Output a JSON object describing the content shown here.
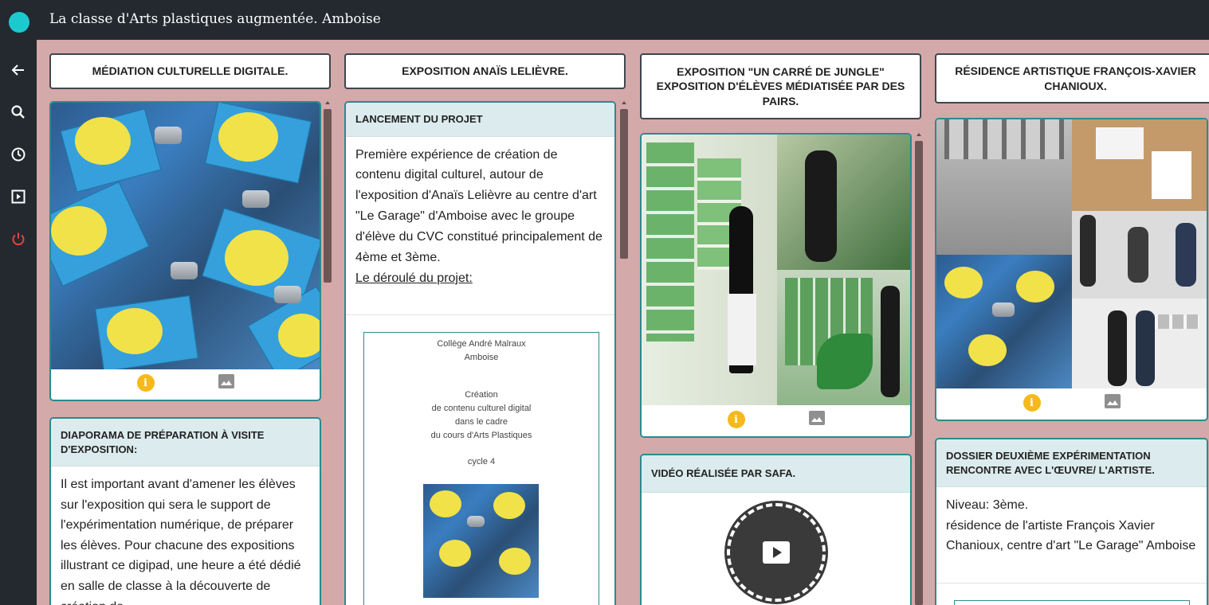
{
  "app": {
    "title": "La classe d'Arts plastiques augmentée. Amboise"
  },
  "sidebar": {
    "items": [
      {
        "icon": "back-arrow-icon"
      },
      {
        "icon": "search-icon"
      },
      {
        "icon": "clock-icon"
      },
      {
        "icon": "slideshow-icon"
      },
      {
        "icon": "power-icon"
      }
    ]
  },
  "colors": {
    "background": "#d4a9a9",
    "topbar": "#23292f",
    "accent_teal": "#2b8a8e",
    "logo": "#1cc9cf",
    "power": "#e0463b",
    "info": "#f5b91b"
  },
  "columns": [
    {
      "header": "MÉDIATION CULTURELLE DIGITALE.",
      "cards": [
        {
          "type": "image",
          "alt": "Parlons art badges"
        },
        {
          "type": "text",
          "title": "DIAPORAMA DE PRÉPARATION À VISITE D'EXPOSITION:",
          "body": "Il est important avant d'amener les élèves sur l'exposition qui sera le support de l'expérimentation numérique, de préparer les élèves. Pour chacune des expositions illustrant ce digipad, une heure a été dédié en salle de classe à la découverte de création de"
        }
      ]
    },
    {
      "header": "EXPOSITION ANAÏS LELIÈVRE.",
      "cards": [
        {
          "type": "text",
          "title": "LANCEMENT DU PROJET",
          "body": "Première expérience de création de contenu digital culturel, autour de l'exposition d'Anaïs Lelièvre au centre d'art \"Le Garage\" d'Amboise avec le groupe d'élève du CVC constitué principalement de 4ème et 3ème.",
          "link": "Le déroulé du projet:"
        }
      ],
      "doc": {
        "line1": "Collège André Malraux",
        "line2": "Amboise",
        "line3": "Création",
        "line4": "de contenu culturel digital",
        "line5": "dans le cadre",
        "line6": "du cours d'Arts Plastiques",
        "line7": "cycle 4"
      }
    },
    {
      "header": "EXPOSITION \"UN CARRÉ DE JUNGLE\" EXPOSITION D'ÉLÈVES MÉDIATISÉE PAR DES PAIRS.",
      "cards": [
        {
          "type": "image",
          "alt": "Un carré de jungle exhibition"
        },
        {
          "type": "video",
          "title": "VIDÉO RÉALISÉE PAR SAFA."
        }
      ]
    },
    {
      "header": "RÉSIDENCE ARTISTIQUE FRANÇOIS-XAVIER CHANIOUX.",
      "cards": [
        {
          "type": "image",
          "alt": "Résidence collage"
        },
        {
          "type": "text",
          "title": "DOSSIER DEUXIÈME EXPÉRIMENTATION RENCONTRE AVEC L'ŒUVRE/ L'ARTISTE.",
          "body_lines": [
            "Niveau: 3ème.",
            "résidence de l'artiste François Xavier Chanioux, centre d'art \"Le Garage\" Amboise"
          ]
        }
      ]
    }
  ]
}
